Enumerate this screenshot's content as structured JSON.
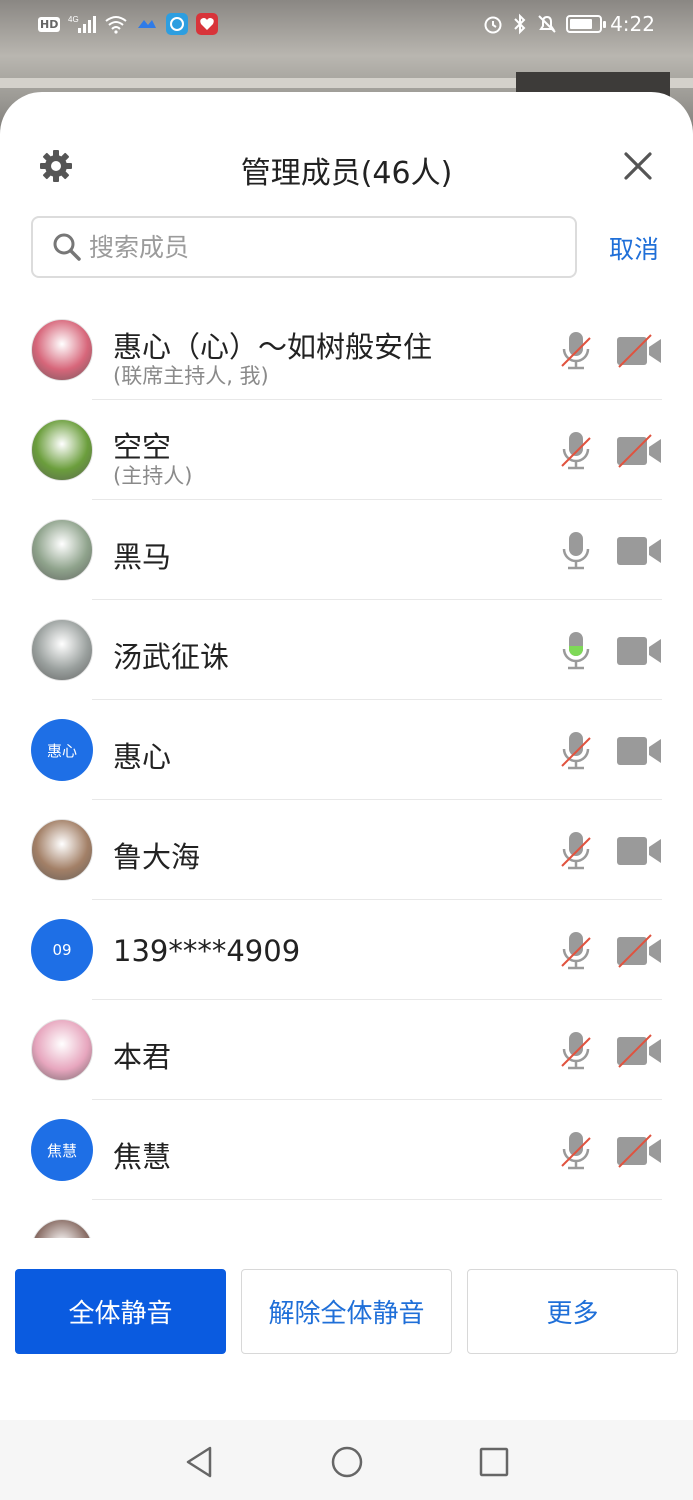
{
  "status_bar": {
    "hd_label": "HD",
    "network_label": "4G",
    "time": "4:22"
  },
  "sheet": {
    "title": "管理成员(46人)",
    "search": {
      "placeholder": "搜索成员",
      "value": ""
    },
    "cancel_label": "取消"
  },
  "members": [
    {
      "name": "惠心（心）～如树般安住",
      "role": "(联席主持人, 我)",
      "avatar": "image",
      "avatar_color": "#d7667a",
      "mic": "muted",
      "camera": "off"
    },
    {
      "name": "空空",
      "role": "(主持人)",
      "avatar": "image",
      "avatar_color": "#6b9e3c",
      "mic": "muted",
      "camera": "off"
    },
    {
      "name": "黑马",
      "role": "",
      "avatar": "image",
      "avatar_color": "#8fa38c",
      "mic": "on",
      "camera": "on"
    },
    {
      "name": "汤武征诛",
      "role": "",
      "avatar": "image",
      "avatar_color": "#9aa09e",
      "mic": "speaking",
      "camera": "on"
    },
    {
      "name": "惠心",
      "role": "",
      "avatar": "text",
      "avatar_text": "惠心",
      "mic": "muted",
      "camera": "on"
    },
    {
      "name": "鲁大海",
      "role": "",
      "avatar": "image",
      "avatar_color": "#a38067",
      "mic": "muted",
      "camera": "on"
    },
    {
      "name": "139****4909",
      "role": "",
      "avatar": "text",
      "avatar_text": "09",
      "mic": "muted",
      "camera": "off"
    },
    {
      "name": "本君",
      "role": "",
      "avatar": "image",
      "avatar_color": "#e7a6be",
      "mic": "muted",
      "camera": "off"
    },
    {
      "name": "焦慧",
      "role": "",
      "avatar": "text",
      "avatar_text": "焦慧",
      "mic": "muted",
      "camera": "off"
    }
  ],
  "actions": {
    "mute_all": "全体静音",
    "unmute_all": "解除全体静音",
    "more": "更多"
  },
  "colors": {
    "accent": "#1f6fd8",
    "primary_button": "#0a5be0",
    "mute_slash": "#e0533f",
    "speaking_green": "#7ed957",
    "icon_gray": "#9a9a9a"
  }
}
